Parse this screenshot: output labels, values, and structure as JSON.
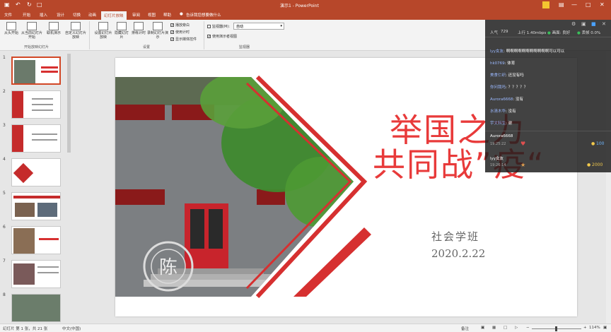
{
  "window": {
    "title": "演示1 - PowerPoint",
    "file_tab": "文件"
  },
  "tabs": [
    "开始",
    "插入",
    "设计",
    "切换",
    "动画",
    "幻灯片放映",
    "审阅",
    "视图",
    "帮助",
    "告诉我您想要做什么"
  ],
  "ribbon": {
    "buttons": [
      "从头开始",
      "从当前幻灯片开始",
      "联机演示",
      "自定义幻灯片放映",
      "设置幻灯片放映",
      "隐藏幻灯片",
      "排练计时",
      "录制幻灯片演示"
    ],
    "group1": "开始放映幻灯片",
    "group2": "设置",
    "group3": "监视器",
    "checks": [
      "播放旁白",
      "使用计时",
      "显示媒体控件",
      "使用演示者视图"
    ],
    "monitor_label": "监视器(M):",
    "monitor_value": "自动"
  },
  "slides": [
    "1",
    "2",
    "3",
    "4",
    "5",
    "6",
    "7",
    "8"
  ],
  "slide": {
    "title_line1": "举国之力",
    "title_line2": "共同战”疫“",
    "subtitle": "社会学班",
    "date": "2020.2.22",
    "seal_char": "陈"
  },
  "status": {
    "slide_info": "幻灯片 第 1 张，共 21 张",
    "lang": "中文(中国)",
    "notes": "备注",
    "zoom": "114%"
  },
  "live": {
    "viewers_label": "人气",
    "viewers": "729",
    "upload": "上行 1.40mbps",
    "quality": "画面: 良好",
    "loss": "丢帧 0.0%",
    "comments": [
      {
        "user": "lyy女友",
        "text": "啊啊啊啊啊啊啊啊啊啊啊可以可以"
      },
      {
        "user": "hk0769",
        "text": "体育"
      },
      {
        "user": "美食仁织",
        "text": "还没有吗"
      },
      {
        "user": "你问我吗",
        "text": "？？？？？"
      },
      {
        "user": "Aurora6668",
        "text": "没有"
      },
      {
        "user": "水清木华",
        "text": "没有"
      },
      {
        "user": "宇文科生",
        "text": "谢"
      }
    ],
    "gifts": [
      {
        "user": "Aurora6668",
        "time": "19:25:22",
        "amount": "100"
      },
      {
        "user": "lyy女友",
        "time": "19:26:14",
        "amount": "2000"
      }
    ]
  }
}
